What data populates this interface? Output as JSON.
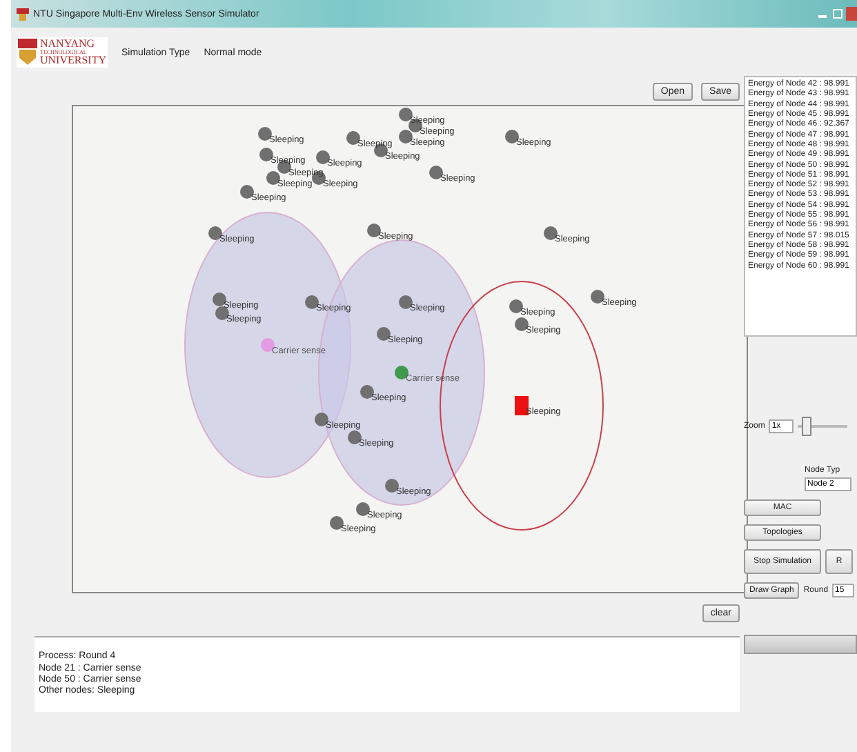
{
  "window": {
    "title": "NTU Singapore Multi-Env Wireless Sensor Simulator"
  },
  "logo": {
    "lines": [
      "NANYANG",
      "TECHNOLOGICAL",
      "UNIVERSITY"
    ]
  },
  "simulation_type": {
    "label": "Simulation Type",
    "value": "Normal mode"
  },
  "file_buttons": [
    "Open",
    "Save"
  ],
  "energy_list": [
    "Energy of Node 42 : 98.991",
    "Energy of Node 43 : 98.991",
    "Energy of Node 44 : 98.991",
    "Energy of Node 45 : 98.991",
    "Energy of Node 46 : 92.367",
    "Energy of Node 47 : 98.991",
    "Energy of Node 48 : 98.991",
    "Energy of Node 49 : 98.991",
    "Energy of Node 50 : 98.991",
    "Energy of Node 51 : 98.991",
    "Energy of Node 52 : 98.991",
    "Energy of Node 53 : 98.991",
    "Energy of Node 54 : 98.991",
    "Energy of Node 55 : 98.991",
    "Energy of Node 56 : 98.991",
    "Energy of Node 57 : 98.015",
    "Energy of Node 58 : 98.991",
    "Energy of Node 59 : 98.991",
    "Energy of Node 60 : 98.991"
  ],
  "nodes": [
    {
      "kind": "sleeping",
      "label": "Sleeping"
    },
    {
      "kind": "sleeping",
      "label": "Sleeping"
    },
    {
      "kind": "sleeping",
      "label": "Sleeping"
    },
    {
      "kind": "sleeping",
      "label": "Sleeping"
    },
    {
      "kind": "sleeping",
      "label": "Sleeping"
    },
    {
      "kind": "sleeping",
      "label": "Sleeping"
    },
    {
      "kind": "sleeping",
      "label": "Sleeping"
    },
    {
      "kind": "sleeping",
      "label": "Sleeping"
    },
    {
      "kind": "sleeping",
      "label": "Sleeping"
    },
    {
      "kind": "sleeping",
      "label": "Sleeping"
    },
    {
      "kind": "sleeping",
      "label": "Sleeping"
    },
    {
      "kind": "sleeping",
      "label": "Sleeping"
    },
    {
      "kind": "sleeping",
      "label": "Sleeping"
    },
    {
      "kind": "sleeping",
      "label": "Sleeping"
    },
    {
      "kind": "sleeping",
      "label": "Sleeping"
    },
    {
      "kind": "sleeping",
      "label": "Sleeping"
    },
    {
      "kind": "sleeping",
      "label": "Sleeping"
    },
    {
      "kind": "sleeping",
      "label": "Sleeping"
    },
    {
      "kind": "sleeping",
      "label": "Sleeping"
    },
    {
      "kind": "sleeping",
      "label": "Sleeping"
    },
    {
      "kind": "sleeping",
      "label": "Sleeping"
    },
    {
      "kind": "sleeping",
      "label": "Sleeping"
    },
    {
      "kind": "sleeping",
      "label": "Sleeping"
    },
    {
      "kind": "sensing",
      "label": "Carrier sense",
      "color": "#e39be3"
    },
    {
      "kind": "sensing",
      "label": "Carrier sense",
      "color": "#3f9a4c"
    },
    {
      "kind": "sleeping",
      "label": "Sleeping"
    },
    {
      "kind": "target",
      "label": "Sleeping"
    },
    {
      "kind": "sleeping",
      "label": "Sleeping"
    },
    {
      "kind": "sleeping",
      "label": "Sleeping"
    },
    {
      "kind": "sleeping",
      "label": "Sleeping"
    },
    {
      "kind": "sleeping",
      "label": "Sleeping"
    },
    {
      "kind": "sleeping",
      "label": "Sleeping"
    },
    {
      "kind": "sleeping",
      "label": "Sleeping"
    },
    {
      "kind": "sleeping",
      "label": "Sleeping"
    }
  ],
  "clear_button": "clear",
  "process_log": [
    "Process:  Round 4",
    "Node 21 : Carrier sense",
    "Node 50 : Carrier sense",
    "Other nodes: Sleeping"
  ],
  "zoom": {
    "label": "Zoom",
    "value": "1x",
    "level": 0.15
  },
  "node_type": {
    "label": "Node Typ",
    "value": "Node 2"
  },
  "buttons": [
    "MAC",
    "Topologies",
    "Stop Simulation",
    "R"
  ],
  "draw_graph_button": "Draw Graph",
  "round": {
    "label": "Round",
    "value": "15"
  },
  "progress": {
    "level": 1
  }
}
